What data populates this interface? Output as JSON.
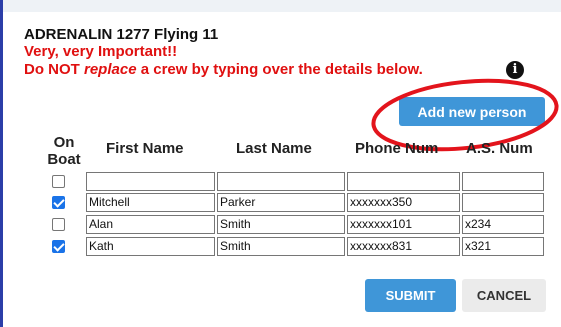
{
  "dialog": {
    "title": "ADRENALIN 1277 Flying 11",
    "warning_line1": "Very, very Important!!",
    "warning_line2_prefix": "Do NOT ",
    "warning_line2_em": "replace",
    "warning_line2_suffix": " a crew by typing over the details below.",
    "info_icon": "info-icon",
    "info_glyph": "i",
    "add_button": "Add new person",
    "annotation_color": "#e3141c"
  },
  "table": {
    "headers": {
      "on_boat_1": "On",
      "on_boat_2": "Boat",
      "first_name": "First Name",
      "last_name": "Last Name",
      "phone": "Phone Num",
      "as_num": "A.S. Num"
    },
    "rows": [
      {
        "checked": false,
        "first": "",
        "last": "",
        "phone": "",
        "as": ""
      },
      {
        "checked": true,
        "first": "Mitchell",
        "last": "Parker",
        "phone": "xxxxxxx350",
        "as": ""
      },
      {
        "checked": false,
        "first": "Alan",
        "last": "Smith",
        "phone": "xxxxxxx101",
        "as": "x234"
      },
      {
        "checked": true,
        "first": "Kath",
        "last": "Smith",
        "phone": "xxxxxxx831",
        "as": "x321"
      }
    ]
  },
  "footer": {
    "submit": "SUBMIT",
    "cancel": "CANCEL"
  },
  "colors": {
    "primary_button": "#3f96d8",
    "warning_text": "#e01010",
    "checkbox_checked": "#1a73e8"
  }
}
